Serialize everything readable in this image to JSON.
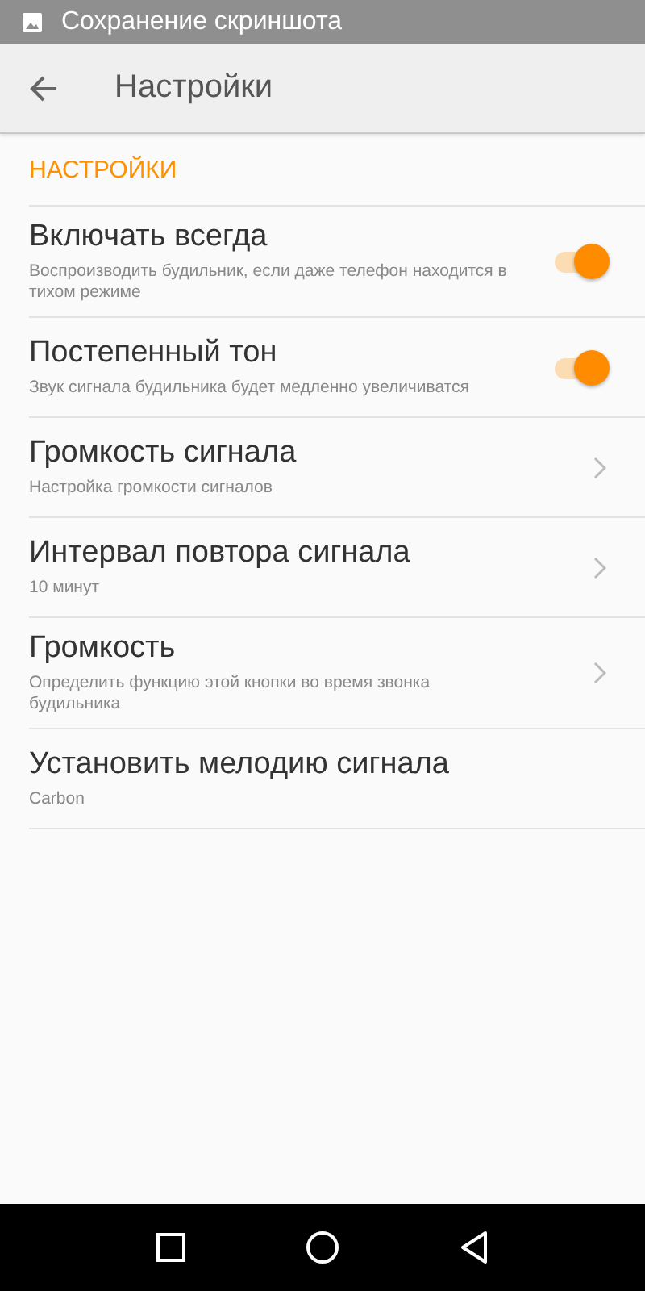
{
  "status_bar": {
    "notification": "Сохранение скриншота"
  },
  "toolbar": {
    "title": "Настройки"
  },
  "section": {
    "header": "НАСТРОЙКИ"
  },
  "items": [
    {
      "kind": "switch",
      "title": "Включать всегда",
      "subtitle": "Воспроизводить будильник, если даже телефон находится в тихом режиме",
      "on": true
    },
    {
      "kind": "switch",
      "title": "Постепенный тон",
      "subtitle": "Звук сигнала будильника будет медленно увеличиватся",
      "on": true
    },
    {
      "kind": "link",
      "title": "Громкость сигнала",
      "subtitle": "Настройка громкости сигналов"
    },
    {
      "kind": "link",
      "title": "Интервал повтора сигнала",
      "subtitle": "10 минут"
    },
    {
      "kind": "link",
      "title": "Громкость",
      "subtitle": "Определить функцию этой кнопки во время звонка будильника"
    },
    {
      "kind": "plain",
      "title": "Установить мелодию сигнала",
      "subtitle": "Carbon"
    }
  ]
}
